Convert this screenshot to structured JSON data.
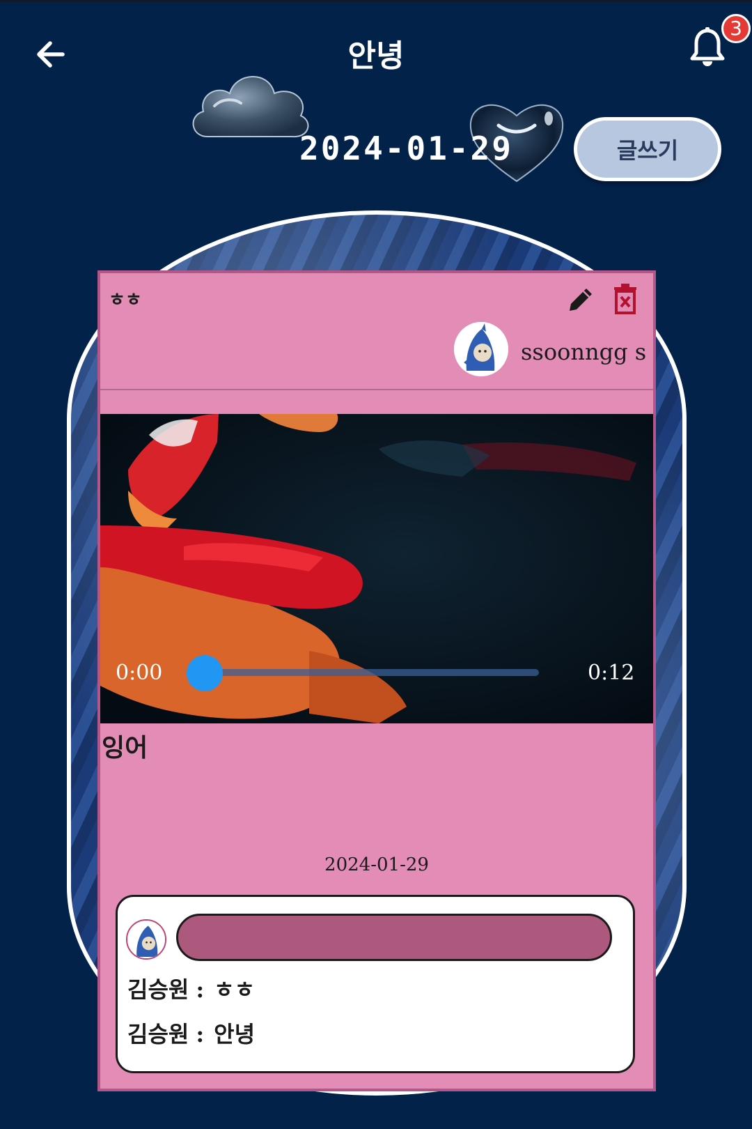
{
  "header": {
    "title": "안녕",
    "notification_count": "3",
    "date": "2024-01-29",
    "write_label": "글쓰기"
  },
  "colors": {
    "background": "#03224a",
    "card": "#e28cb6",
    "accent": "#2196f3",
    "badge": "#e53935",
    "comment_input": "#ad587d",
    "write_button": "#b7c7e0"
  },
  "icons": [
    "back-arrow-icon",
    "bell-icon",
    "cloud-icon",
    "heart-icon",
    "pencil-icon",
    "trash-icon"
  ],
  "post": {
    "title": "ㅎㅎ",
    "author": "ssoonngg s",
    "video": {
      "current_time": "0:00",
      "duration": "0:12",
      "progress": 0
    },
    "body": "잉어",
    "date": "2024-01-29"
  },
  "comments": {
    "input_placeholder": "",
    "items": [
      {
        "author": "김승원",
        "separator": ":",
        "text": "ㅎㅎ"
      },
      {
        "author": "김승원",
        "separator": ":",
        "text": "안녕"
      }
    ]
  }
}
